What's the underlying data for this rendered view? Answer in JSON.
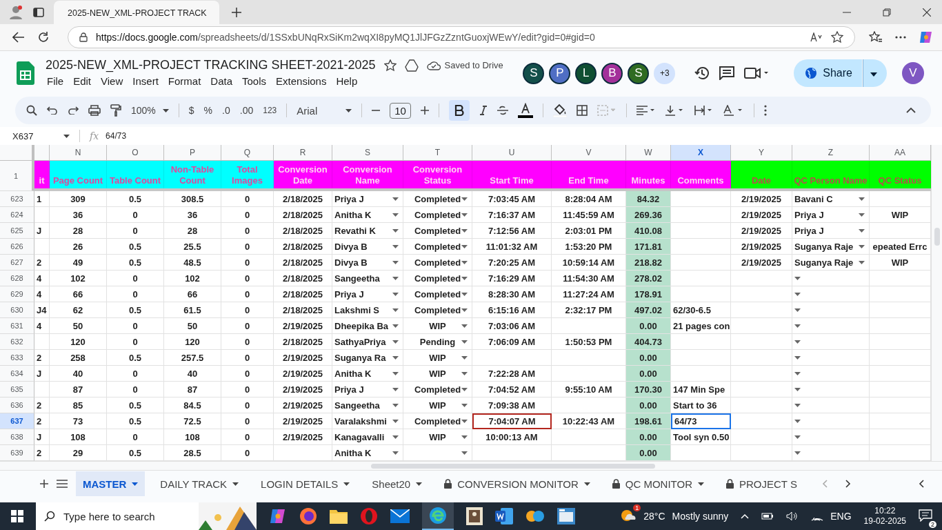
{
  "browser": {
    "tab_title": "2025-NEW_XML-PROJECT TRACK",
    "url_host": "https://docs.google.com",
    "url_path": "/spreadsheets/d/1SSxbUNqRxSiKm2wqXI8pyMQ1JlJFGzZzntGuoxjWEwY/edit?gid=0#gid=0"
  },
  "document": {
    "title": "2025-NEW_XML-PROJECT TRACKING SHEET-2021-2025",
    "save_status": "Saved to Drive",
    "menus": [
      "File",
      "Edit",
      "View",
      "Insert",
      "Format",
      "Data",
      "Tools",
      "Extensions",
      "Help"
    ],
    "collaborators": [
      {
        "initial": "S",
        "color": "#134f4a"
      },
      {
        "initial": "P",
        "color": "#4f6ec4"
      },
      {
        "initial": "L",
        "color": "#0f4f32"
      },
      {
        "initial": "B",
        "color": "#a3309a"
      },
      {
        "initial": "S",
        "color": "#2f6b22"
      }
    ],
    "more_collaborators": "+3",
    "share": "Share",
    "account": "V"
  },
  "toolbar": {
    "zoom": "100%",
    "currency": "$",
    "percent": "%",
    "decrease_decimals": ".0",
    "increase_decimals": ".00",
    "number_format": "123",
    "font": "Arial",
    "font_size": "10",
    "bold": true
  },
  "formula_bar": {
    "cell": "X637",
    "fx": "fx",
    "value": "64/73"
  },
  "grid": {
    "header_row_number": "1",
    "columns": [
      {
        "header": "it",
        "color": "#ff00ff",
        "kind": "note",
        "selected": false
      },
      {
        "letter": "N",
        "header": "Page Count",
        "color": "#00ffff",
        "kind": "value",
        "selected": false
      },
      {
        "letter": "O",
        "header": "Table Count",
        "color": "#00ffff",
        "kind": "value",
        "selected": false
      },
      {
        "letter": "P",
        "header": "Non-Table Count",
        "color": "#00ffff",
        "kind": "value",
        "selected": false
      },
      {
        "letter": "Q",
        "header": "Total Images",
        "color": "#00ffff",
        "kind": "value",
        "selected": false
      },
      {
        "letter": "R",
        "header": "Conversion Date",
        "color": "#ff00ff",
        "kind": "value",
        "selected": false
      },
      {
        "letter": "S",
        "header": "Conversion Name",
        "color": "#ff00ff",
        "kind": "pick",
        "selected": false
      },
      {
        "letter": "T",
        "header": "Conversion Status",
        "color": "#ff00ff",
        "kind": "status",
        "selected": false
      },
      {
        "letter": "U",
        "header": "Start Time",
        "color": "#ff00ff",
        "kind": "value",
        "selected": false,
        "collaborator_cursor": true
      },
      {
        "letter": "V",
        "header": "End Time",
        "color": "#ff00ff",
        "kind": "value",
        "selected": false
      },
      {
        "letter": "W",
        "header": "Minutes",
        "color": "#ff00ff",
        "kind": "value",
        "selected": false,
        "shaded": true
      },
      {
        "letter": "X",
        "header": "Comments",
        "color": "#ff00ff",
        "kind": "note",
        "selected": true
      },
      {
        "letter": "Y",
        "header": "Date",
        "color": "#00ff00",
        "kind": "value",
        "selected": false
      },
      {
        "letter": "Z",
        "header": "QC Person Name",
        "color": "#00ff00",
        "kind": "pick",
        "selected": false
      },
      {
        "letter": "AA",
        "header": "QC Status",
        "color": "#00ff00",
        "kind": "value",
        "selected": false
      }
    ],
    "rows": [
      {
        "number": "623",
        "selected": false,
        "cells": [
          "1",
          "309",
          "0.5",
          "308.5",
          "0",
          "2/18/2025",
          "Priya J",
          "Completed",
          "7:03:45 AM",
          "8:28:04 AM",
          "84.32",
          "",
          "2/19/2025",
          "Bavani C",
          ""
        ]
      },
      {
        "number": "624",
        "selected": false,
        "cells": [
          "",
          "36",
          "0",
          "36",
          "0",
          "2/18/2025",
          "Anitha K",
          "Completed",
          "7:16:37 AM",
          "11:45:59 AM",
          "269.36",
          "",
          "2/19/2025",
          "Priya J",
          "WIP"
        ]
      },
      {
        "number": "625",
        "selected": false,
        "cells": [
          "J",
          "28",
          "0",
          "28",
          "0",
          "2/18/2025",
          "Revathi K",
          "Completed",
          "7:12:56 AM",
          "2:03:01 PM",
          "410.08",
          "",
          "2/19/2025",
          "Priya J",
          ""
        ]
      },
      {
        "number": "626",
        "selected": false,
        "cells": [
          "",
          "26",
          "0.5",
          "25.5",
          "0",
          "2/18/2025",
          "Divya B",
          "Completed",
          "11:01:32 AM",
          "1:53:20 PM",
          "171.81",
          "",
          "2/19/2025",
          "Suganya Raje",
          "epeated Errc"
        ]
      },
      {
        "number": "627",
        "selected": false,
        "cells": [
          "2",
          "49",
          "0.5",
          "48.5",
          "0",
          "2/18/2025",
          "Divya B",
          "Completed",
          "7:20:25 AM",
          "10:59:14 AM",
          "218.82",
          "",
          "2/19/2025",
          "Suganya Raje",
          "WIP"
        ]
      },
      {
        "number": "628",
        "selected": false,
        "cells": [
          "4",
          "102",
          "0",
          "102",
          "0",
          "2/18/2025",
          "Sangeetha",
          "Completed",
          "7:16:29 AM",
          "11:54:30 AM",
          "278.02",
          "",
          "",
          "",
          ""
        ]
      },
      {
        "number": "629",
        "selected": false,
        "cells": [
          "4",
          "66",
          "0",
          "66",
          "0",
          "2/18/2025",
          "Priya J",
          "Completed",
          "8:28:30 AM",
          "11:27:24 AM",
          "178.91",
          "",
          "",
          "",
          ""
        ]
      },
      {
        "number": "630",
        "selected": false,
        "cells": [
          "J4",
          "62",
          "0.5",
          "61.5",
          "0",
          "2/18/2025",
          "Lakshmi S",
          "Completed",
          "6:15:16 AM",
          "2:32:17 PM",
          "497.02",
          "62/30-6.5",
          "",
          "",
          ""
        ]
      },
      {
        "number": "631",
        "selected": false,
        "cells": [
          "4",
          "50",
          "0",
          "50",
          "0",
          "2/19/2025",
          "Dheepika Ba",
          "WIP",
          "7:03:06 AM",
          "",
          "0.00",
          "21 pages con",
          "",
          "",
          ""
        ]
      },
      {
        "number": "632",
        "selected": false,
        "cells": [
          "",
          "120",
          "0",
          "120",
          "0",
          "2/18/2025",
          "SathyaPriya",
          "Pending",
          "7:06:09 AM",
          "1:50:53 PM",
          "404.73",
          "",
          "",
          "",
          ""
        ]
      },
      {
        "number": "633",
        "selected": false,
        "cells": [
          "2",
          "258",
          "0.5",
          "257.5",
          "0",
          "2/19/2025",
          "Suganya Ra",
          "WIP",
          "",
          "",
          "0.00",
          "",
          "",
          "",
          ""
        ]
      },
      {
        "number": "634",
        "selected": false,
        "cells": [
          "J",
          "40",
          "0",
          "40",
          "0",
          "2/19/2025",
          "Anitha K",
          "WIP",
          "7:22:28 AM",
          "",
          "0.00",
          "",
          "",
          "",
          ""
        ]
      },
      {
        "number": "635",
        "selected": false,
        "cells": [
          "",
          "87",
          "0",
          "87",
          "0",
          "2/19/2025",
          "Priya J",
          "Completed",
          "7:04:52 AM",
          "9:55:10 AM",
          "170.30",
          "147 Min Spe",
          "",
          "",
          ""
        ]
      },
      {
        "number": "636",
        "selected": false,
        "cells": [
          "2",
          "85",
          "0.5",
          "84.5",
          "0",
          "2/19/2025",
          "Sangeetha",
          "WIP",
          "7:09:38 AM",
          "",
          "0.00",
          "Start to 36",
          "",
          "",
          ""
        ]
      },
      {
        "number": "637",
        "selected": true,
        "collaborator_cursor": true,
        "cells": [
          "2",
          "73",
          "0.5",
          "72.5",
          "0",
          "2/19/2025",
          "Varalakshmi",
          "Completed",
          "7:04:07 AM",
          "10:22:43 AM",
          "198.61",
          "64/73",
          "",
          "",
          ""
        ]
      },
      {
        "number": "638",
        "selected": false,
        "cells": [
          "J",
          "108",
          "0",
          "108",
          "0",
          "2/19/2025",
          "Kanagavalli",
          "WIP",
          "10:00:13 AM",
          "",
          "0.00",
          "Tool syn 0.50",
          "",
          "",
          ""
        ]
      },
      {
        "number": "639",
        "selected": false,
        "cells": [
          "2",
          "29",
          "0.5",
          "28.5",
          "0",
          "",
          "Anitha K",
          "",
          "",
          "",
          "0.00",
          "",
          "",
          "",
          ""
        ]
      }
    ]
  },
  "sheet_tabs": [
    {
      "label": "MASTER",
      "selected": true,
      "locked": false
    },
    {
      "label": "DAILY TRACK",
      "selected": false,
      "locked": false
    },
    {
      "label": "LOGIN DETAILS",
      "selected": false,
      "locked": false
    },
    {
      "label": "Sheet20",
      "selected": false,
      "locked": false
    },
    {
      "label": "CONVERSION MONITOR",
      "selected": false,
      "locked": true
    },
    {
      "label": "QC MONITOR",
      "selected": false,
      "locked": true
    },
    {
      "label": "PROJECT S",
      "selected": false,
      "locked": true
    }
  ],
  "taskbar": {
    "search_placeholder": "Type here to search",
    "weather_alert": "1",
    "temperature": "28°C",
    "weather": "Mostly sunny",
    "language": "ENG",
    "time": "10:22",
    "date": "19-02-2025",
    "notifications": "2"
  }
}
